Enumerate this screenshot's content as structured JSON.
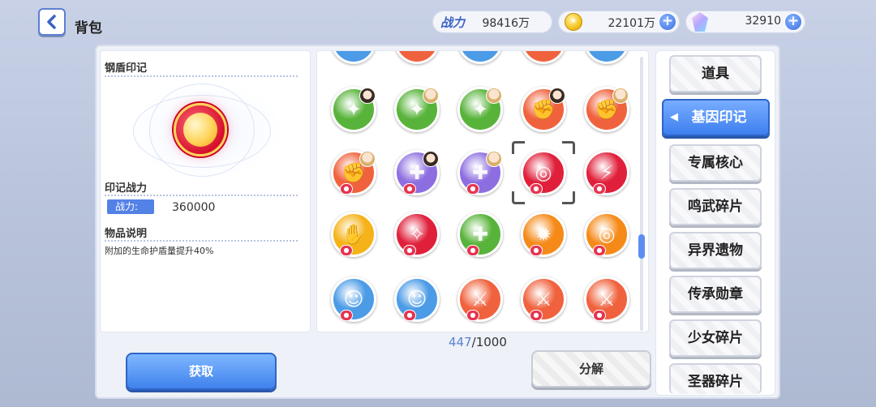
{
  "header": {
    "title": "背包",
    "power_label": "战力",
    "power_value": "98416万",
    "coins_value": "22101万",
    "gems_value": "32910"
  },
  "detail": {
    "item_name": "钢盾印记",
    "power_section": "印记战力",
    "power_tag": "战力:",
    "power_value": "360000",
    "desc_section": "物品说明",
    "desc_text": "附加的生命护盾量提升40%"
  },
  "inventory": {
    "count_current": "447",
    "count_total": "/1000",
    "rows": [
      [
        {
          "icon": "gun-icon",
          "color": "#58b33a",
          "avatar": "dark"
        },
        {
          "icon": "gun-icon",
          "color": "#58b33a",
          "avatar": "light"
        },
        {
          "icon": "gun-icon",
          "color": "#58b33a",
          "avatar": "light"
        },
        {
          "icon": "fist-icon",
          "color": "#f0623d",
          "avatar": "dark"
        },
        {
          "icon": "fist-icon",
          "color": "#f0623d",
          "avatar": "light"
        }
      ],
      [
        {
          "icon": "fist-icon",
          "color": "#f0623d",
          "avatar": "light"
        },
        {
          "icon": "medic-cross-icon",
          "color": "#8d6ee0",
          "avatar": "dark"
        },
        {
          "icon": "medic-cross-icon",
          "color": "#8d6ee0",
          "avatar": "light"
        },
        {
          "icon": "shield-imprint-icon",
          "color": "#e0203b",
          "selected": true
        },
        {
          "icon": "claw-icon",
          "color": "#e0203b"
        }
      ],
      [
        {
          "icon": "paw-icon",
          "color": "#f5b319"
        },
        {
          "icon": "feather-icon",
          "color": "#e0203b"
        },
        {
          "icon": "heal-shield-icon",
          "color": "#58b33a"
        },
        {
          "icon": "burst-icon",
          "color": "#f58a19"
        },
        {
          "icon": "shield-imprint-icon",
          "color": "#f58a19"
        }
      ],
      [
        {
          "icon": "ghost-icon",
          "color": "#4b9be6"
        },
        {
          "icon": "ghost-icon",
          "color": "#4b9be6"
        },
        {
          "icon": "blade-icon",
          "color": "#f0623d"
        },
        {
          "icon": "blade-icon",
          "color": "#f0623d"
        },
        {
          "icon": "blade-icon",
          "color": "#f0623d"
        }
      ]
    ]
  },
  "buttons": {
    "get": "获取",
    "decompose": "分解"
  },
  "tabs": [
    {
      "label": "道具"
    },
    {
      "label": "基因印记",
      "active": true
    },
    {
      "label": "专属核心"
    },
    {
      "label": "鸣武碎片"
    },
    {
      "label": "异界遗物"
    },
    {
      "label": "传承勋章"
    },
    {
      "label": "少女碎片"
    },
    {
      "label": "圣器碎片"
    }
  ]
}
